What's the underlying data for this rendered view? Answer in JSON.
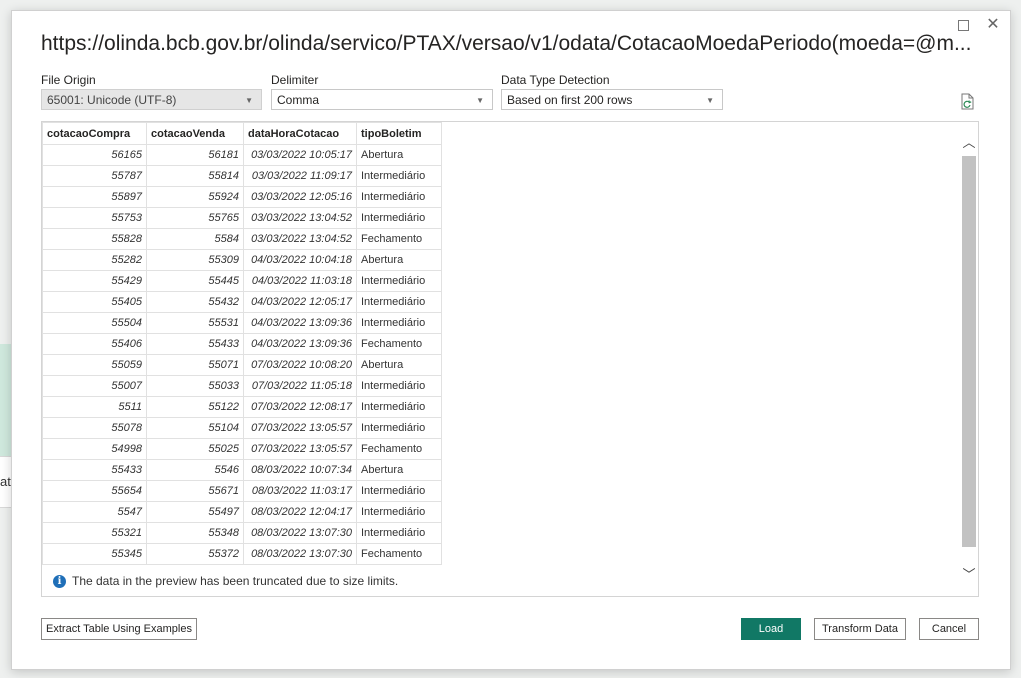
{
  "background": {
    "partial_text": "at"
  },
  "dialog": {
    "title": "https://olinda.bcb.gov.br/olinda/servico/PTAX/versao/v1/odata/CotacaoMoedaPeriodo(moeda=@m...",
    "window_controls": {
      "maximize_icon": "maximize-icon",
      "close_icon": "close-icon",
      "close_glyph": "✕"
    }
  },
  "options": {
    "file_origin": {
      "label": "File Origin",
      "value": "65001: Unicode (UTF-8)"
    },
    "delimiter": {
      "label": "Delimiter",
      "value": "Comma"
    },
    "data_type_detection": {
      "label": "Data Type Detection",
      "value": "Based on first 200 rows"
    },
    "refresh_icon": "refresh-file-icon"
  },
  "table": {
    "columns": [
      "cotacaoCompra",
      "cotacaoVenda",
      "dataHoraCotacao",
      "tipoBoletim"
    ],
    "rows": [
      [
        "56165",
        "56181",
        "03/03/2022 10:05:17",
        "Abertura"
      ],
      [
        "55787",
        "55814",
        "03/03/2022 11:09:17",
        "Intermediário"
      ],
      [
        "55897",
        "55924",
        "03/03/2022 12:05:16",
        "Intermediário"
      ],
      [
        "55753",
        "55765",
        "03/03/2022 13:04:52",
        "Intermediário"
      ],
      [
        "55828",
        "5584",
        "03/03/2022 13:04:52",
        "Fechamento"
      ],
      [
        "55282",
        "55309",
        "04/03/2022 10:04:18",
        "Abertura"
      ],
      [
        "55429",
        "55445",
        "04/03/2022 11:03:18",
        "Intermediário"
      ],
      [
        "55405",
        "55432",
        "04/03/2022 12:05:17",
        "Intermediário"
      ],
      [
        "55504",
        "55531",
        "04/03/2022 13:09:36",
        "Intermediário"
      ],
      [
        "55406",
        "55433",
        "04/03/2022 13:09:36",
        "Fechamento"
      ],
      [
        "55059",
        "55071",
        "07/03/2022 10:08:20",
        "Abertura"
      ],
      [
        "55007",
        "55033",
        "07/03/2022 11:05:18",
        "Intermediário"
      ],
      [
        "5511",
        "55122",
        "07/03/2022 12:08:17",
        "Intermediário"
      ],
      [
        "55078",
        "55104",
        "07/03/2022 13:05:57",
        "Intermediário"
      ],
      [
        "54998",
        "55025",
        "07/03/2022 13:05:57",
        "Fechamento"
      ],
      [
        "55433",
        "5546",
        "08/03/2022 10:07:34",
        "Abertura"
      ],
      [
        "55654",
        "55671",
        "08/03/2022 11:03:17",
        "Intermediário"
      ],
      [
        "5547",
        "55497",
        "08/03/2022 12:04:17",
        "Intermediário"
      ],
      [
        "55321",
        "55348",
        "08/03/2022 13:07:30",
        "Intermediário"
      ],
      [
        "55345",
        "55372",
        "08/03/2022 13:07:30",
        "Fechamento"
      ]
    ]
  },
  "info": {
    "icon": "info-icon",
    "icon_glyph": "i",
    "message": "The data in the preview has been truncated due to size limits."
  },
  "buttons": {
    "extract": "Extract Table Using Examples",
    "load": "Load",
    "transform": "Transform Data",
    "cancel": "Cancel"
  },
  "colors": {
    "load_button": "#117865",
    "info_icon": "#1f6fb8"
  }
}
